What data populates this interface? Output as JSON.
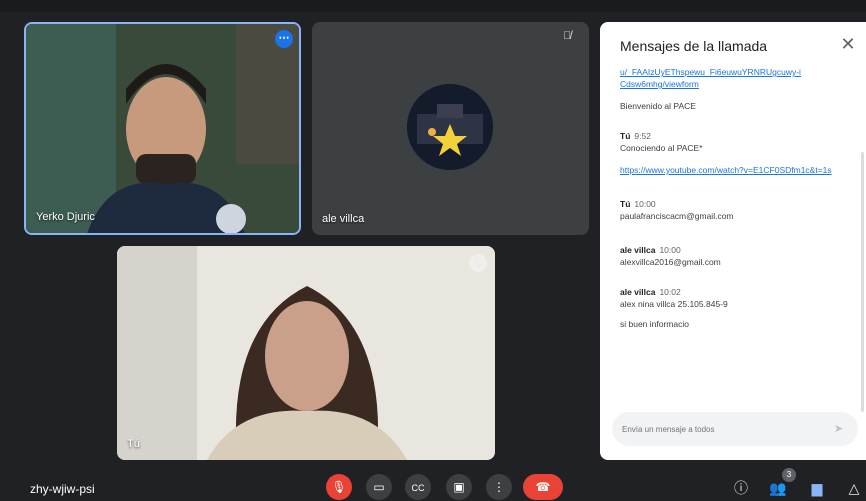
{
  "tiles": {
    "yerko": {
      "name": "Yerko Djuric"
    },
    "ale": {
      "name": "ale villca"
    },
    "tu": {
      "name": "Tú"
    }
  },
  "chat": {
    "title": "Mensajes de la llamada",
    "close_icon": "close-icon",
    "messages": [
      {
        "sender": "",
        "time": "",
        "link": "u/_FAAIzUyEThspewu_Fi6euwuYRNRUgcuwy-i Cdsw6mhg/viewform",
        "text": "Bienvenido al PACE"
      },
      {
        "sender": "Tú",
        "time": "9:52",
        "text": "Conociendo al PACE*",
        "link": "https://www.youtube.com/watch?v=E1CF0SDfm1c&t=1s"
      },
      {
        "sender": "Tú",
        "time": "10:00",
        "text": "paulafranciscacm@gmail.com"
      },
      {
        "sender": "ale villca",
        "time": "10:00",
        "text": "alexvillca2016@gmail.com"
      },
      {
        "sender": "ale villca",
        "time": "10:02",
        "text": "alex nina villca 25.105.845-9",
        "text2": "si buen informacio"
      }
    ],
    "input_placeholder": "Envía un mensaje a todos"
  },
  "bottom": {
    "meeting_code": "zhy-wjiw-psi",
    "people_count": "3"
  },
  "colors": {
    "background": "#202124",
    "accent": "#1a73e8",
    "danger": "#ea4335",
    "active_border": "#8ab4f8"
  },
  "icons": [
    "more-options-icon",
    "mic-off-icon",
    "camera-icon",
    "captions-icon",
    "present-icon",
    "more-vert-icon",
    "call-end-icon",
    "info-icon",
    "people-icon",
    "chat-icon",
    "activities-icon",
    "send-icon"
  ]
}
